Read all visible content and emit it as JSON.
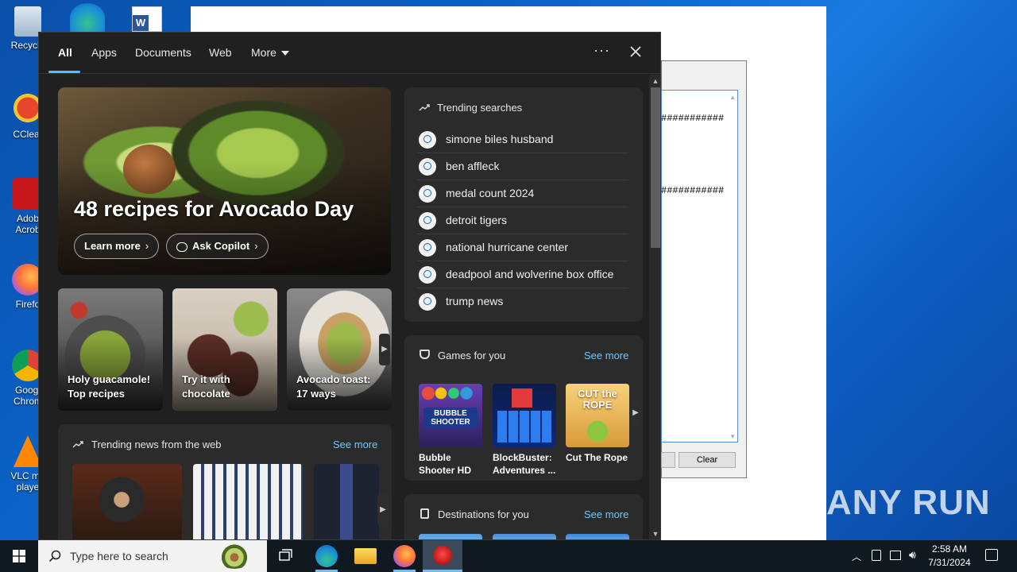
{
  "desktop": {
    "icons": [
      {
        "label": "Recycle"
      },
      {
        "label": "CClear"
      },
      {
        "label": "Adob Acrob"
      },
      {
        "label": "Firefo"
      },
      {
        "label": "Googl Chrom"
      },
      {
        "label": "VLC me playe"
      }
    ]
  },
  "background_window": {
    "hash_text_1": "###########",
    "hash_text_2": "###########",
    "clear_button": "Clear"
  },
  "watermark": "ANY RUN",
  "search_panel": {
    "tabs": [
      {
        "label": "All",
        "active": true
      },
      {
        "label": "Apps"
      },
      {
        "label": "Documents"
      },
      {
        "label": "Web"
      },
      {
        "label": "More"
      }
    ],
    "options_label": "···",
    "hero": {
      "title": "48 recipes for Avocado Day",
      "learn_more": "Learn more",
      "ask_copilot": "Ask Copilot"
    },
    "recipe_cards": [
      {
        "caption": "Holy guacamole! Top recipes"
      },
      {
        "caption": "Try it with chocolate"
      },
      {
        "caption": "Avocado toast: 17 ways"
      }
    ],
    "news": {
      "title": "Trending news from the web",
      "see_more": "See more"
    },
    "trending": {
      "title": "Trending searches",
      "items": [
        "simone biles husband",
        "ben affleck",
        "medal count 2024",
        "detroit tigers",
        "national hurricane center",
        "deadpool and wolverine box office",
        "trump news"
      ]
    },
    "games": {
      "title": "Games for you",
      "see_more": "See more",
      "items": [
        {
          "name": "Bubble Shooter HD",
          "art_text": "BUBBLE SHOOTER"
        },
        {
          "name": "BlockBuster: Adventures ..."
        },
        {
          "name": "Cut The Rope",
          "art_text": "CUT the ROPE"
        }
      ]
    },
    "destinations": {
      "title": "Destinations for you",
      "see_more": "See more"
    }
  },
  "taskbar": {
    "search_placeholder": "Type here to search",
    "time": "2:58 AM",
    "date": "7/31/2024"
  },
  "colors": {
    "accent": "#4cc2ff",
    "link": "#6cc8ff",
    "panel_bg": "#202020",
    "card_bg": "#2b2b2b"
  }
}
